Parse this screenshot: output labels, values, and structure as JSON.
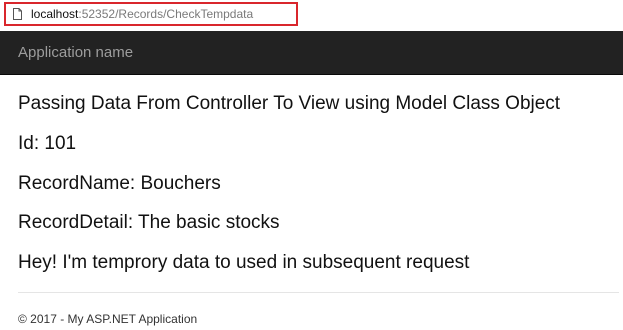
{
  "browser": {
    "url_host": "localhost",
    "url_rest": ":52352/Records/CheckTempdata",
    "page_icon": "document-icon",
    "highlight_color": "#d9262c"
  },
  "navbar": {
    "brand": "Application name",
    "background": "#222222"
  },
  "main": {
    "heading": "Passing Data From Controller To View using Model Class Object",
    "id_line": "Id: 101",
    "record_name_line": "RecordName: Bouchers",
    "record_detail_line": "RecordDetail: The basic stocks",
    "temp_message": "Hey! I'm temprory data to used in subsequent request"
  },
  "footer": {
    "text": "© 2017 - My ASP.NET Application"
  }
}
